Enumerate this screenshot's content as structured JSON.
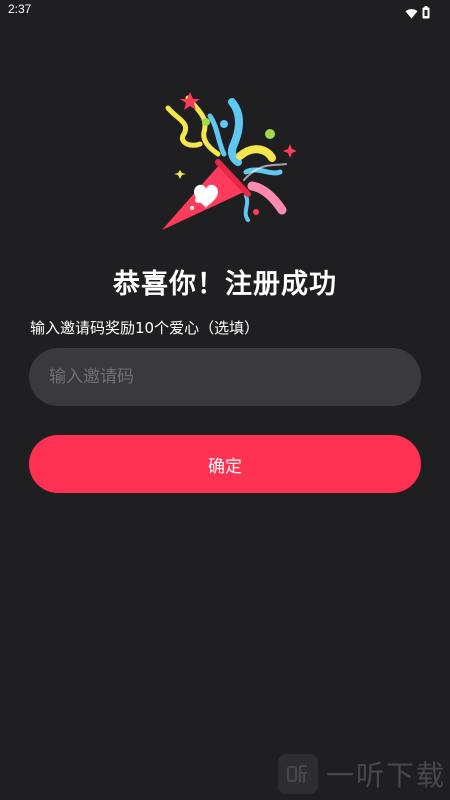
{
  "status_bar": {
    "time": "2:37",
    "icons": [
      "wifi-icon",
      "battery-icon"
    ]
  },
  "illustration": {
    "icon": "party-popper-icon",
    "colors": {
      "cone": "#ff3b5c",
      "heart": "#ffffff",
      "streamer_yellow": "#f5e64b",
      "streamer_blue": "#5ec8f2",
      "streamer_pink": "#ff8ab0",
      "star": "#ff3b5c"
    }
  },
  "main": {
    "title": "恭喜你！注册成功",
    "invite_label": "输入邀请码奖励10个爱心（选填）",
    "invite_placeholder": "输入邀请码",
    "invite_value": "",
    "confirm_label": "确定"
  },
  "watermark": {
    "text": "一听下载"
  },
  "colors": {
    "background": "#1f1f21",
    "input_bg": "#3a3a3e",
    "accent": "#fe3152"
  }
}
